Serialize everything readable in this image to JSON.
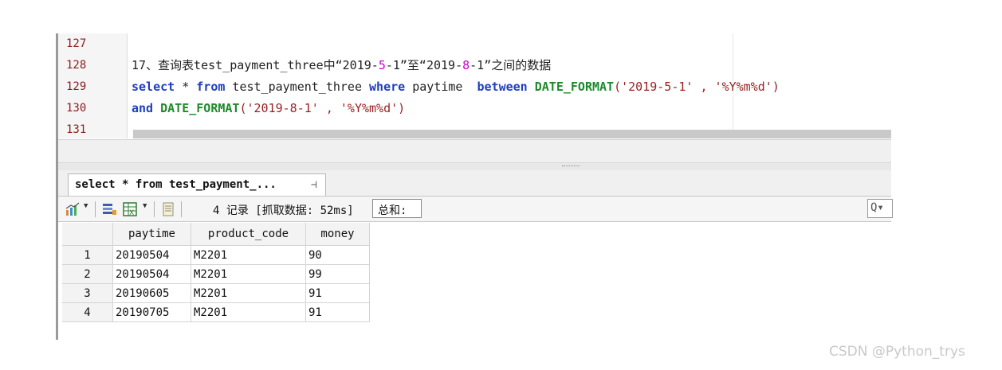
{
  "editor": {
    "line_numbers": [
      "127",
      "128",
      "129",
      "130",
      "131"
    ],
    "comment_line": {
      "prefix": "17、查询表test_payment_three中“2019-",
      "p1": "5",
      "mid1": "-1”至“2019-",
      "p2": "8",
      "suffix": "-1”之间的数据"
    },
    "line129": {
      "kw1": "select",
      "t1": " * ",
      "kw2": "from",
      "t2": " test_payment_three ",
      "kw3": "where",
      "t3": " paytime  ",
      "kw4": "between",
      "t4": " ",
      "fn1": "DATE_FORMAT",
      "s1": "('2019-5-1' , '%Y%m%d')"
    },
    "line130": {
      "kw1": "and",
      "t1": " ",
      "fn1": "DATE_FORMAT",
      "s1": "('2019-8-1' , '%Y%m%d')"
    }
  },
  "results": {
    "tab_label": "select * from test_payment_...",
    "pin_glyph": "⊣",
    "status_text": "4 记录 [抓取数据: 52ms]",
    "sum_label": "总和:",
    "filter_glyph": "Q▾",
    "columns": [
      "paytime",
      "product_code",
      "money"
    ],
    "rows": [
      {
        "num": "1",
        "paytime": "20190504",
        "product_code": "M2201",
        "money": "90"
      },
      {
        "num": "2",
        "paytime": "20190504",
        "product_code": "M2201",
        "money": "99"
      },
      {
        "num": "3",
        "paytime": "20190605",
        "product_code": "M2201",
        "money": "91"
      },
      {
        "num": "4",
        "paytime": "20190705",
        "product_code": "M2201",
        "money": "91"
      }
    ]
  },
  "toolbar_icons": [
    "chart-icon",
    "table-config-icon",
    "export-excel-icon",
    "notes-icon"
  ],
  "colors": {
    "keyword": "#1f3fbf",
    "function": "#1d8a2a",
    "string": "#9a1f1f",
    "highlight": "#d000d0",
    "line_number": "#8b2020"
  },
  "watermark": "CSDN @Python_trys"
}
